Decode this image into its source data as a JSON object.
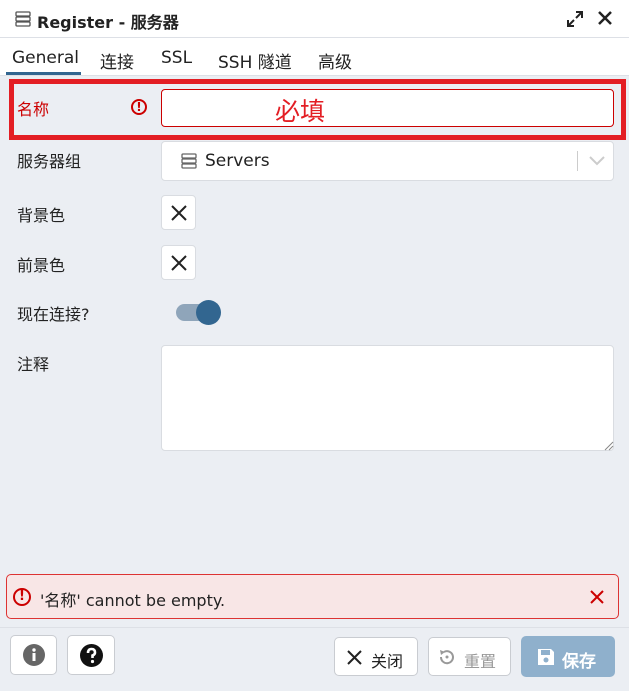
{
  "window": {
    "title": "Register - 服务器",
    "icons": [
      "server-icon",
      "expand-icon",
      "close-icon"
    ]
  },
  "tabs": [
    {
      "label": "General",
      "active": true
    },
    {
      "label": "连接"
    },
    {
      "label": "SSL"
    },
    {
      "label": "SSH 隧道"
    },
    {
      "label": "高级"
    }
  ],
  "form": {
    "name": {
      "label": "名称",
      "value": "",
      "required_note": "必填"
    },
    "server_group": {
      "label": "服务器组",
      "value": "Servers"
    },
    "background": {
      "label": "背景色"
    },
    "foreground": {
      "label": "前景色"
    },
    "connect_now": {
      "label": "现在连接?",
      "on": true
    },
    "comment": {
      "label": "注释",
      "value": ""
    }
  },
  "error": {
    "message": "'名称' cannot be empty."
  },
  "footer": {
    "close_label": "关闭",
    "reset_label": "重置",
    "save_label": "保存"
  },
  "colors": {
    "accent": "#326690",
    "error": "#cc0000",
    "highlight": "#e31e24",
    "save_disabled": "#8fb0cc"
  }
}
